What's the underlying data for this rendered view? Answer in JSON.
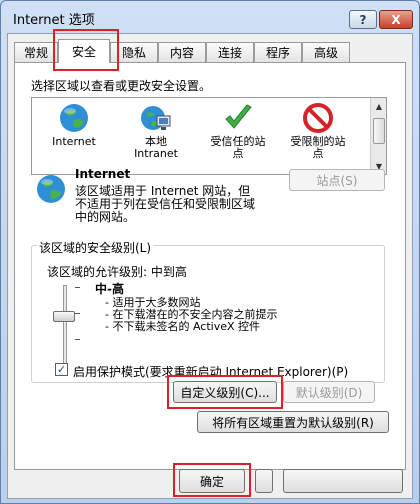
{
  "window": {
    "title": "Internet 选项",
    "help_label": "?",
    "close_label": "X"
  },
  "tabs": [
    "常规",
    "安全",
    "隐私",
    "内容",
    "连接",
    "程序",
    "高级"
  ],
  "zone_prompt": "选择区域以查看或更改安全设置。",
  "zones": [
    {
      "lines": [
        "Internet"
      ],
      "icon": "globe-icon"
    },
    {
      "lines": [
        "本地",
        "Intranet"
      ],
      "icon": "intranet-icon"
    },
    {
      "lines": [
        "受信任的站",
        "点"
      ],
      "icon": "checkmark-icon"
    },
    {
      "lines": [
        "受限制的站",
        "点"
      ],
      "icon": "restricted-icon"
    }
  ],
  "selected_zone": {
    "name": "Internet",
    "description": [
      "该区域适用于 Internet 网站，但",
      "不适用于列在受信任和受限制区域",
      "中的网站。"
    ]
  },
  "sites_button": "站点(S)",
  "security_level": {
    "group_title": "该区域的安全级别(L)",
    "allowed_label": "该区域的允许级别: 中到高",
    "level_name": "中-高",
    "bullets": [
      "- 适用于大多数网站",
      "- 在下载潜在的不安全内容之前提示",
      "- 不下载未签名的 ActiveX 控件"
    ]
  },
  "protected_mode": {
    "label": "启用保护模式(要求重新启动 Internet Explorer)(P)",
    "checked": true,
    "mark": "✓"
  },
  "custom_level_button": "自定义级别(C)...",
  "default_level_button": "默认级别(D)",
  "reset_all_button": "将所有区域重置为默认级别(R)",
  "ok_button": "确定"
}
